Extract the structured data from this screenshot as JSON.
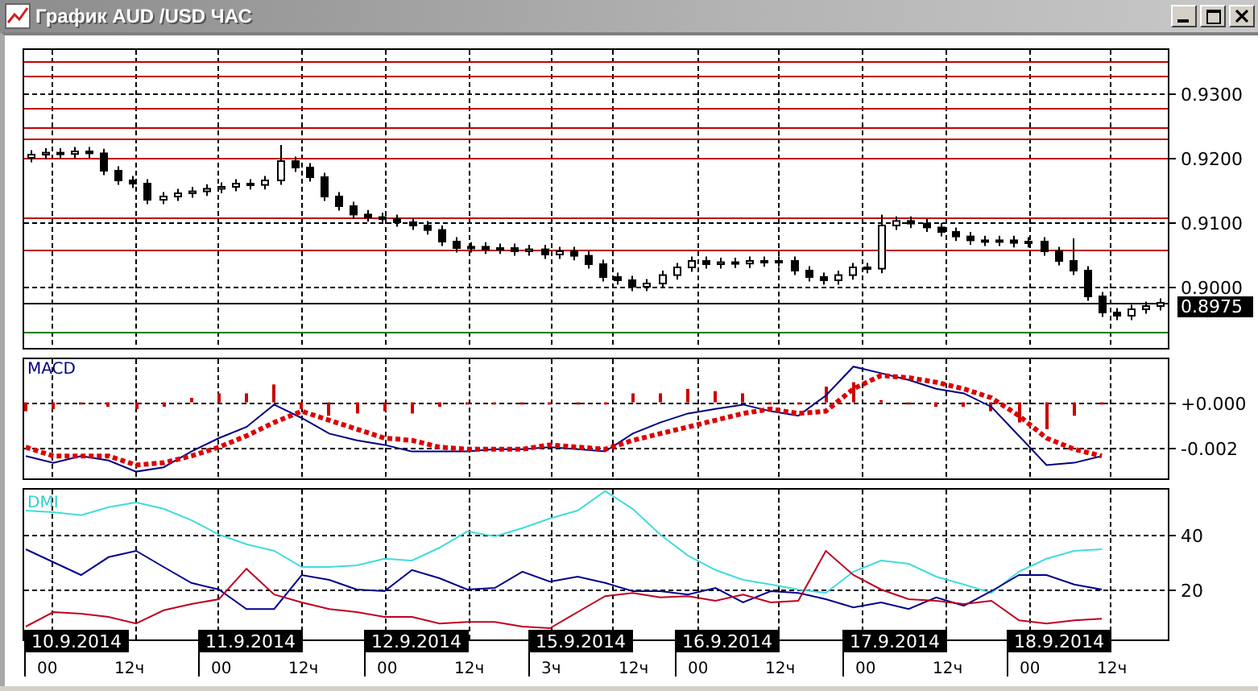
{
  "window": {
    "title": "График AUD /USD ЧАС"
  },
  "price_panel": {
    "current_price": "0.8975",
    "chart_data": {
      "type": "candlestick",
      "grid": true,
      "ylim": [
        0.8905,
        0.937
      ],
      "yticks": [
        {
          "value": 0.93,
          "label": "0.9300"
        },
        {
          "value": 0.92,
          "label": "0.9200"
        },
        {
          "value": 0.91,
          "label": "0.9100"
        },
        {
          "value": 0.9,
          "label": "0.9000"
        }
      ],
      "ohlc": [
        [
          0.92,
          0.9212,
          0.9193,
          0.9205
        ],
        [
          0.9205,
          0.9215,
          0.9198,
          0.9208
        ],
        [
          0.9208,
          0.9215,
          0.9199,
          0.9206
        ],
        [
          0.9206,
          0.9217,
          0.9199,
          0.921
        ],
        [
          0.921,
          0.9217,
          0.92,
          0.9207
        ],
        [
          0.9207,
          0.9214,
          0.9173,
          0.918
        ],
        [
          0.918,
          0.9187,
          0.9158,
          0.9165
        ],
        [
          0.9165,
          0.9172,
          0.9153,
          0.916
        ],
        [
          0.916,
          0.9167,
          0.9128,
          0.9135
        ],
        [
          0.9135,
          0.9147,
          0.9128,
          0.914
        ],
        [
          0.914,
          0.9152,
          0.9133,
          0.9145
        ],
        [
          0.9145,
          0.9155,
          0.9138,
          0.9148
        ],
        [
          0.9148,
          0.9159,
          0.9141,
          0.9152
        ],
        [
          0.9152,
          0.9162,
          0.9145,
          0.9155
        ],
        [
          0.9155,
          0.9167,
          0.9148,
          0.916
        ],
        [
          0.916,
          0.9167,
          0.9151,
          0.9158
        ],
        [
          0.9158,
          0.9172,
          0.9151,
          0.9165
        ],
        [
          0.9165,
          0.922,
          0.9158,
          0.9195
        ],
        [
          0.9195,
          0.9202,
          0.9178,
          0.9185
        ],
        [
          0.9185,
          0.9192,
          0.9163,
          0.917
        ],
        [
          0.917,
          0.9177,
          0.9133,
          0.914
        ],
        [
          0.914,
          0.9147,
          0.9118,
          0.9125
        ],
        [
          0.9125,
          0.9132,
          0.9105,
          0.9112
        ],
        [
          0.9112,
          0.9119,
          0.9101,
          0.9108
        ],
        [
          0.9108,
          0.9115,
          0.9098,
          0.9105
        ],
        [
          0.9105,
          0.9112,
          0.9093,
          0.91
        ],
        [
          0.91,
          0.9107,
          0.9088,
          0.9095
        ],
        [
          0.9095,
          0.9102,
          0.9081,
          0.9088
        ],
        [
          0.9088,
          0.9095,
          0.9063,
          0.907
        ],
        [
          0.907,
          0.9077,
          0.9053,
          0.906
        ],
        [
          0.906,
          0.9069,
          0.9053,
          0.9062
        ],
        [
          0.9062,
          0.9069,
          0.9051,
          0.9058
        ],
        [
          0.9058,
          0.9067,
          0.9051,
          0.906
        ],
        [
          0.906,
          0.9067,
          0.9048,
          0.9055
        ],
        [
          0.9055,
          0.9065,
          0.9048,
          0.9058
        ],
        [
          0.9058,
          0.9065,
          0.9043,
          0.905
        ],
        [
          0.905,
          0.9062,
          0.9043,
          0.9055
        ],
        [
          0.9055,
          0.9062,
          0.9041,
          0.9048
        ],
        [
          0.9048,
          0.9055,
          0.9028,
          0.9035
        ],
        [
          0.9035,
          0.9042,
          0.9008,
          0.9015
        ],
        [
          0.9015,
          0.9022,
          0.9003,
          0.901
        ],
        [
          0.901,
          0.9017,
          0.8993,
          0.9
        ],
        [
          0.9,
          0.9012,
          0.8993,
          0.9005
        ],
        [
          0.9005,
          0.9025,
          0.8998,
          0.9018
        ],
        [
          0.9018,
          0.9037,
          0.9011,
          0.903
        ],
        [
          0.903,
          0.9047,
          0.9023,
          0.904
        ],
        [
          0.904,
          0.9047,
          0.9028,
          0.9035
        ],
        [
          0.9035,
          0.9045,
          0.9028,
          0.9038
        ],
        [
          0.9038,
          0.9045,
          0.9029,
          0.9036
        ],
        [
          0.9036,
          0.9047,
          0.9029,
          0.904
        ],
        [
          0.904,
          0.9047,
          0.9031,
          0.9038
        ],
        [
          0.9038,
          0.9047,
          0.9031,
          0.904
        ],
        [
          0.904,
          0.9047,
          0.9018,
          0.9025
        ],
        [
          0.9025,
          0.9032,
          0.9008,
          0.9015
        ],
        [
          0.9015,
          0.9022,
          0.9003,
          0.901
        ],
        [
          0.901,
          0.9025,
          0.9003,
          0.9018
        ],
        [
          0.9018,
          0.9037,
          0.9011,
          0.903
        ],
        [
          0.903,
          0.9037,
          0.9021,
          0.9028
        ],
        [
          0.9028,
          0.9112,
          0.9021,
          0.9095
        ],
        [
          0.9095,
          0.9109,
          0.9088,
          0.9102
        ],
        [
          0.9102,
          0.9109,
          0.9091,
          0.9098
        ],
        [
          0.9098,
          0.9105,
          0.9085,
          0.9092
        ],
        [
          0.9092,
          0.9099,
          0.9078,
          0.9085
        ],
        [
          0.9085,
          0.9092,
          0.9071,
          0.9078
        ],
        [
          0.9078,
          0.9085,
          0.9065,
          0.9072
        ],
        [
          0.9072,
          0.9079,
          0.9063,
          0.907
        ],
        [
          0.907,
          0.9079,
          0.9063,
          0.9072
        ],
        [
          0.9072,
          0.9079,
          0.9061,
          0.9068
        ],
        [
          0.9068,
          0.9077,
          0.9061,
          0.907
        ],
        [
          0.907,
          0.9077,
          0.9048,
          0.9055
        ],
        [
          0.9055,
          0.9062,
          0.9033,
          0.904
        ],
        [
          0.904,
          0.9075,
          0.9018,
          0.9025
        ],
        [
          0.9025,
          0.9032,
          0.8978,
          0.8985
        ],
        [
          0.8985,
          0.8992,
          0.8953,
          0.896
        ],
        [
          0.896,
          0.8967,
          0.8948,
          0.8955
        ],
        [
          0.8955,
          0.8972,
          0.8948,
          0.8965
        ],
        [
          0.8965,
          0.8977,
          0.8958,
          0.897
        ],
        [
          0.897,
          0.8982,
          0.8963,
          0.8975
        ]
      ],
      "ref_lines": [
        {
          "axis": "y",
          "value": 0.935,
          "color": "#c00000"
        },
        {
          "axis": "y",
          "value": 0.9328,
          "color": "#c00000"
        },
        {
          "axis": "y",
          "value": 0.9278,
          "color": "#c00000"
        },
        {
          "axis": "y",
          "value": 0.9248,
          "color": "#c00000"
        },
        {
          "axis": "y",
          "value": 0.923,
          "color": "#c00000"
        },
        {
          "axis": "y",
          "value": 0.92,
          "color": "#c00000"
        },
        {
          "axis": "y",
          "value": 0.9108,
          "color": "#c00000"
        },
        {
          "axis": "y",
          "value": 0.9058,
          "color": "#c00000"
        },
        {
          "axis": "y",
          "value": 0.8975,
          "color": "#000000"
        },
        {
          "axis": "y",
          "value": 0.893,
          "color": "#008000"
        }
      ]
    }
  },
  "macd_panel": {
    "label": "MACD",
    "chart_data": {
      "type": "line",
      "grid": true,
      "ylim": [
        -0.0034,
        0.002
      ],
      "yticks": [
        {
          "value": 0,
          "label": "+0.000"
        },
        {
          "value": -0.002,
          "label": "-0.002"
        }
      ],
      "series": [
        {
          "type": "bar",
          "color": "#cc0000",
          "values": [
            -0.0004,
            -0.0003,
            -0.0001,
            -0.0002,
            -0.0003,
            -0.0002,
            0.0002,
            0.0004,
            0.0004,
            0.0008,
            -0.0003,
            -0.0006,
            -0.0005,
            -0.0004,
            -0.0005,
            -0.0002,
            -0.0001,
            -0.0001,
            -0.0001,
            -0.0001,
            -0.0001,
            -0.0001,
            0.0004,
            0.0004,
            0.0006,
            0.0005,
            0.0004,
            -0.0001,
            -0.0001,
            0.0007,
            0.0009,
            0.0001,
            -0.0001,
            -0.0002,
            -0.0002,
            -0.0004,
            -0.0009,
            -0.0012,
            -0.0006,
            -0.0001
          ]
        },
        {
          "color": "#000080",
          "values": [
            -0.0024,
            -0.0027,
            -0.0024,
            -0.0026,
            -0.0031,
            -0.0029,
            -0.0022,
            -0.0016,
            -0.0011,
            -0.0001,
            -0.0007,
            -0.0014,
            -0.0017,
            -0.0019,
            -0.0022,
            -0.0022,
            -0.0022,
            -0.0021,
            -0.0021,
            -0.002,
            -0.0021,
            -0.0022,
            -0.0014,
            -0.0009,
            -0.0005,
            -0.0003,
            -0.0001,
            -0.0004,
            -0.0006,
            0.0003,
            0.0016,
            0.0013,
            0.001,
            0.0006,
            0.0004,
            -0.0002,
            -0.0015,
            -0.0028,
            -0.0027,
            -0.0024
          ]
        },
        {
          "color": "#dd0000",
          "line_style": "dotted",
          "values": [
            -0.002,
            -0.0024,
            -0.0024,
            -0.0024,
            -0.0028,
            -0.0027,
            -0.0024,
            -0.002,
            -0.0015,
            -0.0009,
            -0.0004,
            -0.0008,
            -0.0012,
            -0.0016,
            -0.0017,
            -0.002,
            -0.0021,
            -0.0021,
            -0.0021,
            -0.0019,
            -0.002,
            -0.0021,
            -0.0017,
            -0.0014,
            -0.0011,
            -0.0008,
            -0.0005,
            -0.0003,
            -0.0005,
            -0.0004,
            0.0006,
            0.0012,
            0.0011,
            0.0009,
            0.0006,
            0.0002,
            -0.0006,
            -0.0016,
            -0.0021,
            -0.0024
          ]
        }
      ]
    }
  },
  "dmi_panel": {
    "label": "DMI",
    "chart_data": {
      "type": "line",
      "grid": true,
      "ylim": [
        1.8,
        57
      ],
      "yticks": [
        {
          "value": 40,
          "label": "40"
        },
        {
          "value": 20,
          "label": "20"
        }
      ],
      "series": [
        {
          "color": "#40dcdc",
          "values": [
            48.8,
            48.2,
            47.1,
            50,
            51.8,
            49.4,
            45.3,
            40,
            36.5,
            34.1,
            28.2,
            28.2,
            28.8,
            31.2,
            30.6,
            35.3,
            41.2,
            39.4,
            42.4,
            45.9,
            48.8,
            55.9,
            49.4,
            40,
            32.4,
            27.1,
            23.5,
            21.8,
            20,
            18.8,
            26.5,
            30.6,
            29.4,
            24.7,
            21.8,
            18.8,
            26.5,
            31.2,
            34.1,
            34.7
          ]
        },
        {
          "color": "#00008c",
          "values": [
            34.7,
            30,
            25.3,
            31.8,
            34.1,
            28.2,
            22.4,
            20,
            12.9,
            12.9,
            25.3,
            23.5,
            20,
            19.4,
            27.1,
            24.1,
            20,
            20.6,
            26.5,
            22.9,
            24.7,
            22.4,
            19.4,
            19.4,
            18.2,
            20.6,
            15.3,
            19.4,
            18.8,
            16.5,
            13.5,
            15.3,
            12.9,
            17.1,
            14.1,
            19.4,
            25.3,
            25.3,
            21.8,
            20
          ]
        },
        {
          "color": "#c00020",
          "values": [
            6.5,
            11.8,
            11.2,
            10,
            7.6,
            12.4,
            14.7,
            16.5,
            27.6,
            18.2,
            15.3,
            12.9,
            11.8,
            10,
            10,
            7.6,
            8.2,
            8.2,
            6.5,
            5.9,
            11.8,
            17.6,
            18.8,
            17.1,
            17.6,
            15.9,
            18.2,
            15.3,
            15.9,
            34.1,
            25.3,
            20,
            16.5,
            15.9,
            14.7,
            15.9,
            8.8,
            7.6,
            8.8,
            9.4
          ]
        }
      ]
    }
  },
  "time_axis": [
    {
      "date": "10.9.2014",
      "hours": [
        "00",
        "12ч"
      ]
    },
    {
      "date": "11.9.2014",
      "hours": [
        "00",
        "12ч"
      ]
    },
    {
      "date": "12.9.2014",
      "hours": [
        "00",
        "12ч"
      ]
    },
    {
      "date": "15.9.2014",
      "hours": [
        "3ч",
        "12ч"
      ]
    },
    {
      "date": "16.9.2014",
      "hours": [
        "00",
        "12ч"
      ]
    },
    {
      "date": "17.9.2014",
      "hours": [
        "00",
        "12ч"
      ]
    },
    {
      "date": "18.9.2014",
      "hours": [
        "00",
        "12ч"
      ]
    }
  ]
}
